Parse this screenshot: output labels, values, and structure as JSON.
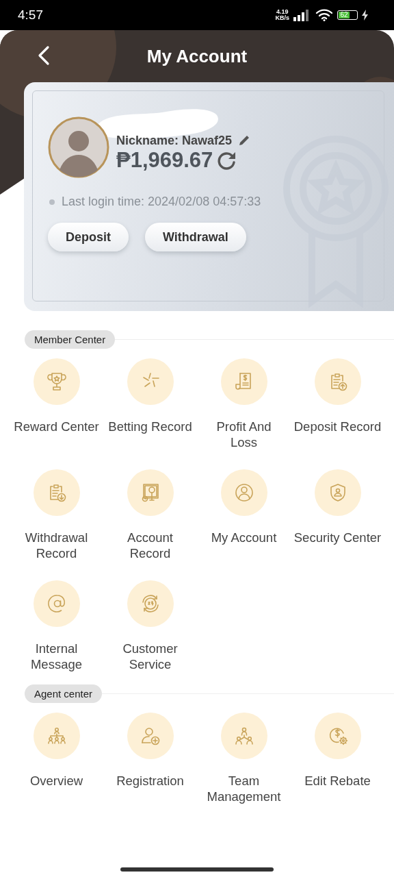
{
  "status_bar": {
    "time": "4:57",
    "net_speed": "4.19",
    "net_unit": "KB/s",
    "battery": "62"
  },
  "header": {
    "title": "My Account"
  },
  "profile": {
    "nickname": "Nickname: Nawaf25",
    "balance": "₱1,969.67",
    "last_login": "Last login time: 2024/02/08 04:57:33"
  },
  "actions": [
    "Deposit",
    "Withdrawal"
  ],
  "sections": [
    {
      "title": "Member Center",
      "items": [
        {
          "label": "Reward Center"
        },
        {
          "label": "Betting Record"
        },
        {
          "label": "Profit And\nLoss"
        },
        {
          "label": "Deposit Record"
        },
        {
          "label": "Withdrawal\nRecord"
        },
        {
          "label": "Account\nRecord"
        },
        {
          "label": "My Account"
        },
        {
          "label": "Security Center"
        },
        {
          "label": "Internal\nMessage"
        },
        {
          "label": "Customer\nService"
        }
      ]
    },
    {
      "title": "Agent center",
      "items": [
        {
          "label": "Overview"
        },
        {
          "label": "Registration"
        },
        {
          "label": "Team\nManagement"
        },
        {
          "label": "Edit Rebate"
        }
      ]
    }
  ]
}
